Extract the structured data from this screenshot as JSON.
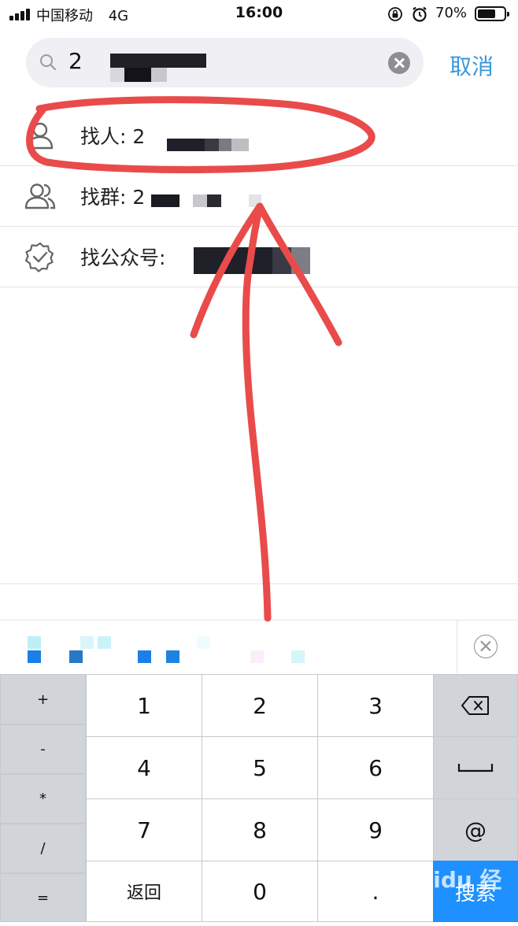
{
  "status_bar": {
    "carrier": "中国移动",
    "network": "4G",
    "time": "16:00",
    "battery": "70%",
    "battery_level": 0.7,
    "signal_bars": 4
  },
  "search": {
    "query": "2",
    "cancel_label": "取消"
  },
  "results": [
    {
      "label": "找人: 2",
      "icon": "person-icon"
    },
    {
      "label": "找群: 2",
      "icon": "group-icon"
    },
    {
      "label": "找公众号:",
      "icon": "verified-badge-icon"
    }
  ],
  "keyboard": {
    "side_keys": [
      "+",
      "-",
      "*",
      "/",
      "="
    ],
    "digit_rows": [
      [
        "1",
        "2",
        "3"
      ],
      [
        "4",
        "5",
        "6"
      ],
      [
        "7",
        "8",
        "9"
      ]
    ],
    "bottom_left": "返回",
    "bottom_mid": "0",
    "bottom_right": ".",
    "at_key": "@",
    "search_label": "搜索"
  },
  "watermark": "Baidu 经验",
  "colors": {
    "accent": "#3a97d8",
    "search_key": "#1e90ff",
    "annotation_red": "#e94b4b",
    "keyboard_bg": "#d1d4d9"
  }
}
